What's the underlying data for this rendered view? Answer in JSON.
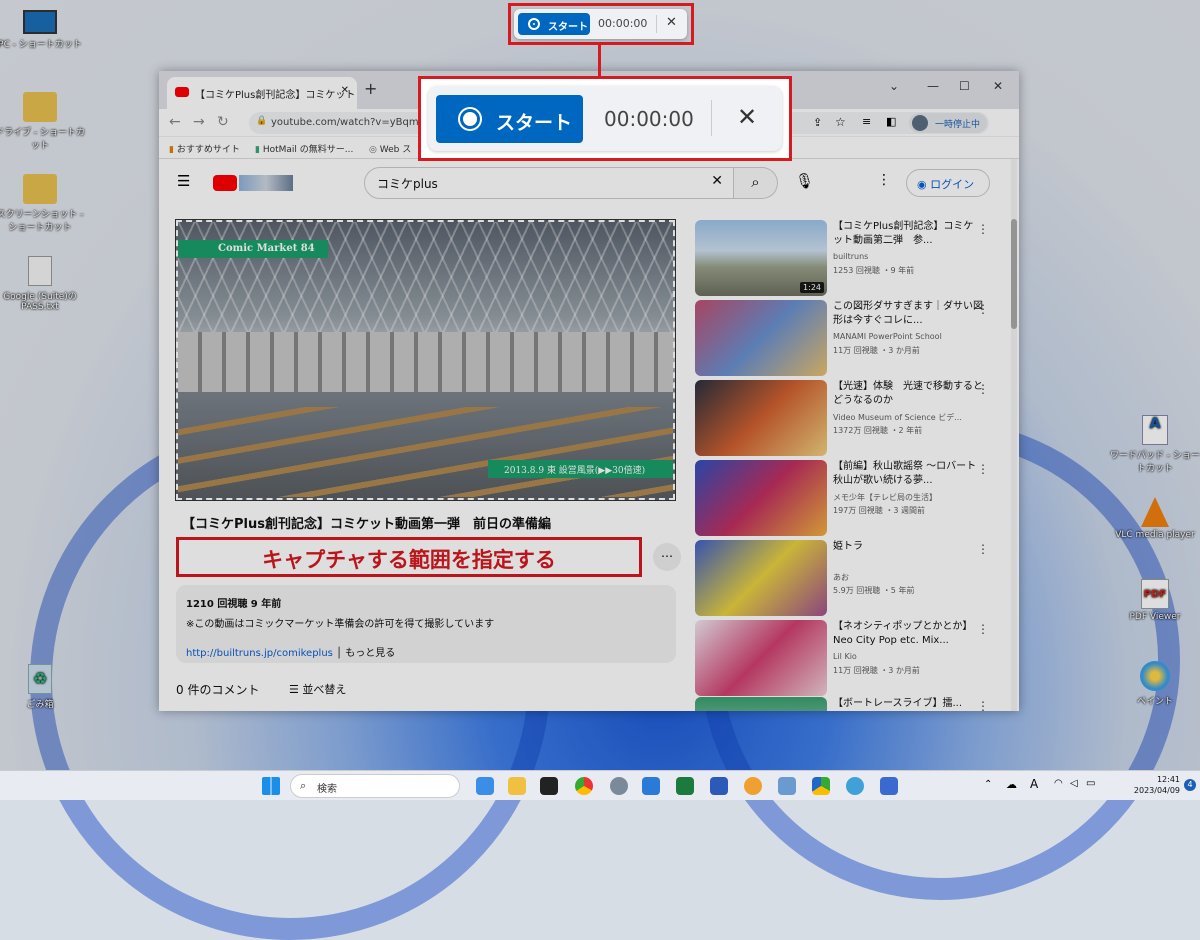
{
  "desktop": {
    "icons": [
      {
        "label": "PC - ショートカット"
      },
      {
        "label": "ドライブ - ショートカット"
      },
      {
        "label": "スクリーンショット - ショートカット"
      },
      {
        "label": "Google (Suite)のPASS.txt"
      },
      {
        "label": "ごみ箱"
      },
      {
        "label": "ワードパッド - ショートカット"
      },
      {
        "label": "VLC media player"
      },
      {
        "label": "PDF Viewer"
      },
      {
        "label": "ペイント"
      }
    ]
  },
  "browser": {
    "tab_title": "【コミケPlus創刊記念】コミケット",
    "url": "youtube.com/watch?v=yBqmcl",
    "pause_label": "一時停止中",
    "bookmarks": [
      "おすすめサイト",
      "HotMail の無料サー...",
      "Web ス"
    ]
  },
  "youtube": {
    "search_value": "コミケplus",
    "login_label": "ログイン",
    "video_banner_top": "Comic Market 84",
    "video_banner_bottom": "2013.8.9 東 設営風景(▶▶30倍速)",
    "video_title": "【コミケPlus創刊記念】コミケット動画第一弾　前日の準備編",
    "callout": "キャプチャする範囲を指定する",
    "views_line": "1210 回視聴  9 年前",
    "description": "※この動画はコミックマーケット準備会の許可を得て撮影しています",
    "link": "http://builtruns.jp/comikeplus",
    "more_label": "もっと見る",
    "comments_label": "0 件のコメント",
    "sort_label": "並べ替え",
    "recommendations": [
      {
        "title": "【コミケPlus創刊記念】コミケット動画第二弾　参...",
        "channel": "builtruns",
        "meta": "1253 回視聴 ・9 年前",
        "duration": "1:24"
      },
      {
        "title": "この図形ダサすぎます｜ダサい図形は今すぐコレに...",
        "channel": "MANAMI PowerPoint School",
        "meta": "11万 回視聴 ・3 か月前"
      },
      {
        "title": "【光速】体験　光速で移動するとどうなるのか",
        "channel": "Video Museum of Science ビデ...",
        "meta": "1372万 回視聴 ・2 年前"
      },
      {
        "title": "【前編】秋山歌謡祭 ～ロバート秋山が歌い続ける夢...",
        "channel": "メモ少年【テレビ局の生活】",
        "meta": "197万 回視聴 ・3 週間前"
      },
      {
        "title": "姫トラ",
        "channel": "あお",
        "meta": "5.9万 回視聴 ・5 年前"
      },
      {
        "title": "【ネオシティポップとかとか】Neo City Pop etc. Mix...",
        "channel": "Lil Kio",
        "meta": "11万 回視聴 ・3 か月前"
      },
      {
        "title": "【ボートレースライブ】擂...",
        "channel": "",
        "meta": ""
      }
    ]
  },
  "recorder": {
    "start_label": "スタート",
    "timer": "00:00:00"
  },
  "taskbar": {
    "search_placeholder": "検索",
    "time": "12:41",
    "date": "2023/04/09",
    "notification_count": "4"
  },
  "colors": {
    "accent_red": "#d71920",
    "start_blue": "#0067c0",
    "youtube_red": "#ff0000"
  }
}
